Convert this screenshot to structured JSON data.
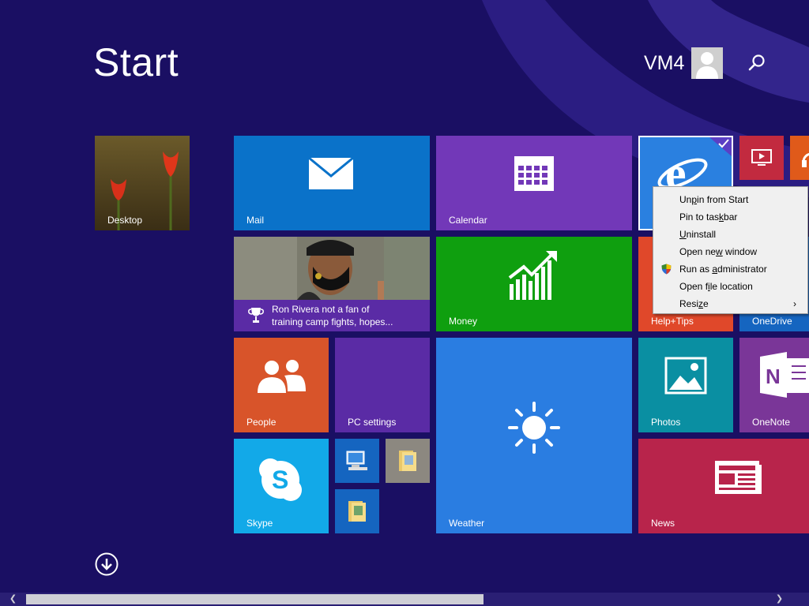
{
  "screen": {
    "title": "Start"
  },
  "user": {
    "name": "VM4"
  },
  "icons": {
    "search": "search-icon",
    "avatar": "user-avatar-icon",
    "all_apps": "arrow-down-circle-icon",
    "shield": "uac-shield-icon"
  },
  "tiles": {
    "desktop": {
      "label": "Desktop"
    },
    "mail": {
      "label": "Mail",
      "color": "#0a72c9"
    },
    "calendar": {
      "label": "Calendar",
      "color": "#7238b8"
    },
    "news_sports": {
      "headline": "Ron Rivera not a fan of training camp fights, hopes...",
      "headline_line1": "Ron Rivera not a fan of",
      "headline_line2": "training camp fights, hopes...",
      "color": "#5a2ba5"
    },
    "money": {
      "label": "Money",
      "color": "#0f9f0f"
    },
    "help_tips": {
      "label": "Help+Tips",
      "color": "#e0482a"
    },
    "onedrive": {
      "label": "OneDrive",
      "color": "#1565c0"
    },
    "people": {
      "label": "People",
      "color": "#d8542a"
    },
    "pc_settings": {
      "label": "PC settings",
      "color": "#5a2ba5"
    },
    "weather": {
      "label": "Weather",
      "color": "#2a7de1"
    },
    "photos": {
      "label": "Photos",
      "color": "#0a8fa2"
    },
    "onenote": {
      "label": "OneNote",
      "color": "#7a3698"
    },
    "skype": {
      "label": "Skype",
      "color": "#12a9e8"
    },
    "news": {
      "label": "News",
      "color": "#b8244b"
    },
    "ie": {
      "color": "#2a80e0"
    },
    "video": {
      "color": "#c22a3f"
    },
    "music": {
      "color": "#e05a1a"
    }
  },
  "context_menu": {
    "items": [
      {
        "label": "Unpin from Start",
        "pre": "Un",
        "u": "p",
        "post": "in from Start"
      },
      {
        "label": "Pin to taskbar",
        "pre": "Pin to tas",
        "u": "k",
        "post": "bar"
      },
      {
        "label": "Uninstall",
        "pre": "",
        "u": "U",
        "post": "ninstall"
      },
      {
        "label": "Open new window",
        "pre": "Open ne",
        "u": "w",
        "post": " window"
      },
      {
        "label": "Run as administrator",
        "pre": "Run as ",
        "u": "a",
        "post": "dministrator"
      },
      {
        "label": "Open file location",
        "pre": "Open f",
        "u": "i",
        "post": "le location"
      },
      {
        "label": "Resize",
        "pre": "Resi",
        "u": "z",
        "post": "e",
        "has_submenu": true
      }
    ]
  }
}
